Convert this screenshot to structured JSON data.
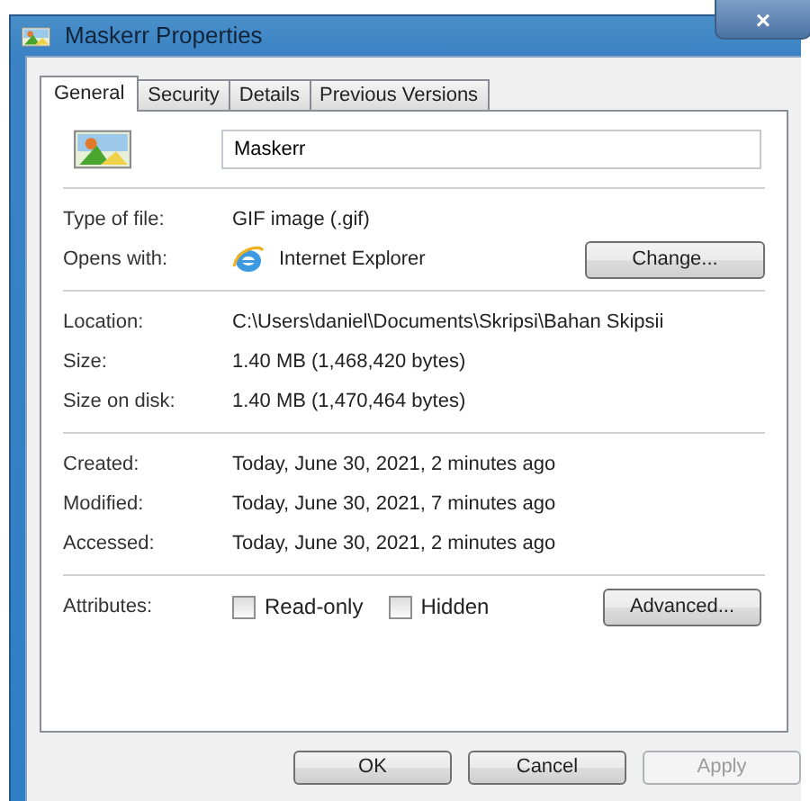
{
  "window": {
    "title": "Maskerr Properties",
    "close": "×"
  },
  "tabs": [
    {
      "label": "General",
      "selected": true
    },
    {
      "label": "Security",
      "selected": false
    },
    {
      "label": "Details",
      "selected": false
    },
    {
      "label": "Previous Versions",
      "selected": false
    }
  ],
  "file_name": "Maskerr",
  "sections": [
    [
      {
        "label": "Type of file:",
        "value": "GIF image (.gif)",
        "kind": "text"
      },
      {
        "label": "Opens with:",
        "value": "Internet Explorer",
        "kind": "app",
        "button": "Change..."
      }
    ],
    [
      {
        "label": "Location:",
        "value": "C:\\Users\\daniel\\Documents\\Skripsi\\Bahan Skipsii",
        "kind": "text"
      },
      {
        "label": "Size:",
        "value": "1.40 MB (1,468,420 bytes)",
        "kind": "text"
      },
      {
        "label": "Size on disk:",
        "value": "1.40 MB (1,470,464 bytes)",
        "kind": "text"
      }
    ],
    [
      {
        "label": "Created:",
        "value": "Today, June 30, 2021, 2 minutes ago",
        "kind": "text"
      },
      {
        "label": "Modified:",
        "value": "Today, June 30, 2021, 7 minutes ago",
        "kind": "text"
      },
      {
        "label": "Accessed:",
        "value": "Today, June 30, 2021, 2 minutes ago",
        "kind": "text"
      }
    ]
  ],
  "attributes": {
    "label": "Attributes:",
    "checkboxes": [
      {
        "label": "Read-only",
        "checked": false
      },
      {
        "label": "Hidden",
        "checked": false
      }
    ],
    "button": "Advanced..."
  },
  "buttons": [
    {
      "label": "OK",
      "disabled": false
    },
    {
      "label": "Cancel",
      "disabled": false
    },
    {
      "label": "Apply",
      "disabled": true
    }
  ]
}
